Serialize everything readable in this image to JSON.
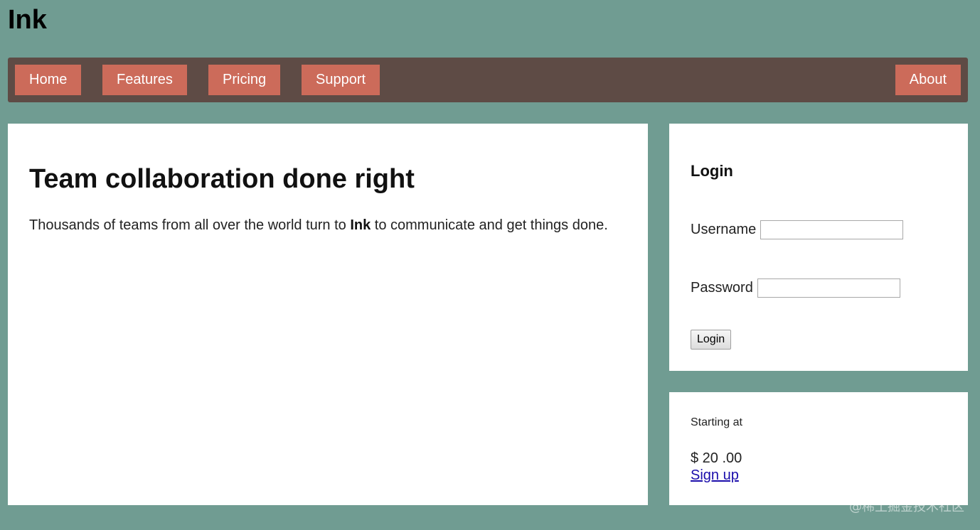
{
  "site": {
    "title": "Ink"
  },
  "nav": {
    "items": [
      {
        "label": "Home"
      },
      {
        "label": "Features"
      },
      {
        "label": "Pricing"
      },
      {
        "label": "Support"
      }
    ],
    "about_label": "About"
  },
  "main": {
    "heading": "Team collaboration done right",
    "intro_before": "Thousands of teams from all over the world turn to ",
    "intro_brand": "Ink",
    "intro_after": " to communicate and get things done."
  },
  "login": {
    "title": "Login",
    "username_label": "Username",
    "username_value": "",
    "password_label": "Password",
    "password_value": "",
    "submit_label": "Login"
  },
  "pricing": {
    "label": "Starting at",
    "price": "$ 20 .00",
    "signup_label": "Sign up"
  },
  "watermark": {
    "text": "@稀土掘金技术社区"
  },
  "colors": {
    "page_background": "#709c92",
    "nav_background": "#5e4b45",
    "nav_item_background": "#cc6b5a",
    "link": "#1a0dab"
  }
}
